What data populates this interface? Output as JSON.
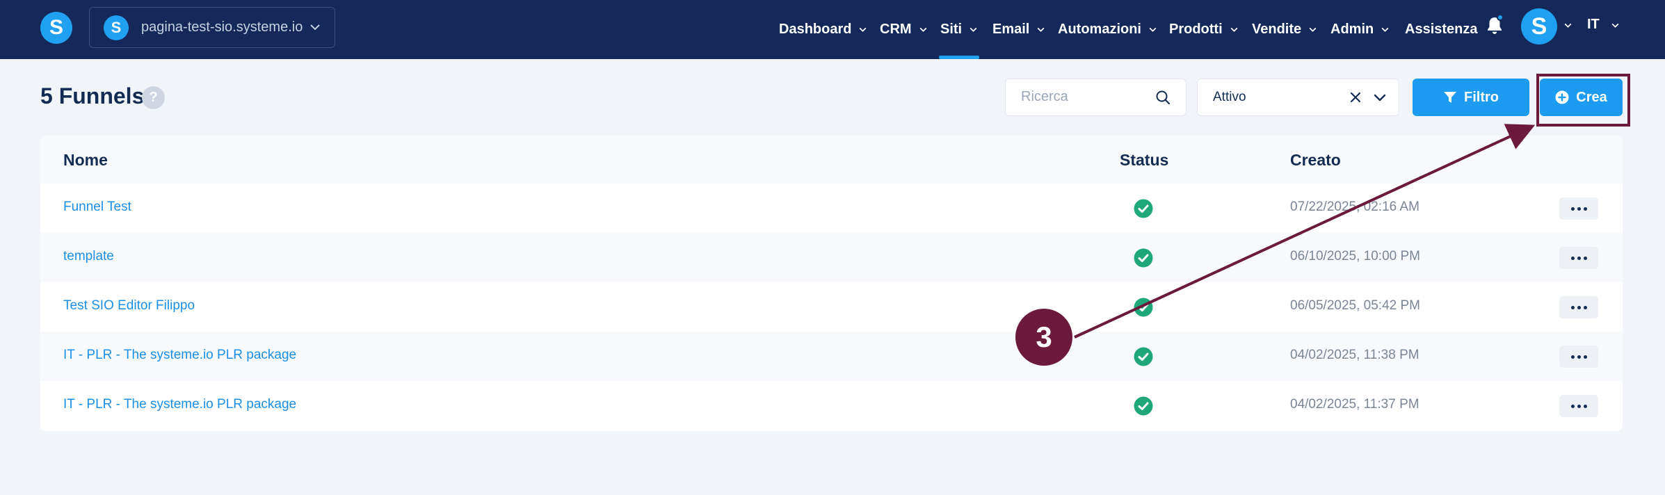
{
  "topbar": {
    "logo_letter": "S",
    "site_switcher": {
      "logo_letter": "S",
      "name": "pagina-test-sio.systeme.io"
    },
    "nav": [
      {
        "label": "Dashboard",
        "active": false
      },
      {
        "label": "CRM",
        "active": false
      },
      {
        "label": "Siti",
        "active": true
      },
      {
        "label": "Email",
        "active": false
      },
      {
        "label": "Automazioni",
        "active": false
      },
      {
        "label": "Prodotti",
        "active": false
      },
      {
        "label": "Vendite",
        "active": false
      },
      {
        "label": "Admin",
        "active": false
      },
      {
        "label": "Assistenza",
        "active": false
      }
    ],
    "notification_icon": "bell-icon",
    "avatar_letter": "S",
    "language": "IT"
  },
  "page": {
    "title": "5 Funnels",
    "help_label": "?"
  },
  "toolbar": {
    "search_placeholder": "Ricerca",
    "status_filter_value": "Attivo",
    "filter_label": "Filtro",
    "create_label": "Crea"
  },
  "table": {
    "columns": {
      "name": "Nome",
      "status": "Status",
      "created": "Creato"
    },
    "rows": [
      {
        "name": "Funnel Test",
        "status": "active",
        "created": "07/22/2025, 02:16 AM"
      },
      {
        "name": "template",
        "status": "active",
        "created": "06/10/2025, 10:00 PM"
      },
      {
        "name": "Test SIO Editor Filippo",
        "status": "active",
        "created": "06/05/2025, 05:42 PM"
      },
      {
        "name": "IT - PLR - The systeme.io PLR package",
        "status": "active",
        "created": "04/02/2025, 11:38 PM"
      },
      {
        "name": "IT - PLR - The systeme.io PLR package",
        "status": "active",
        "created": "04/02/2025, 11:37 PM"
      }
    ]
  },
  "annotation": {
    "step": "3"
  },
  "colors": {
    "topbar": "#14295a",
    "accent": "#1d9bf0",
    "status_ok": "#1fa77a",
    "annotation": "#6b1a3c"
  }
}
